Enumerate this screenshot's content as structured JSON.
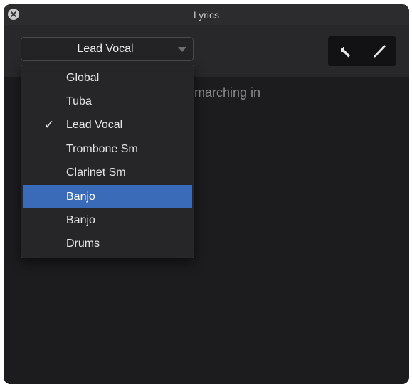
{
  "window": {
    "title": "Lyrics"
  },
  "toolbar": {
    "track_select_value": "Lead Vocal"
  },
  "content": {
    "lyric_text": "marching in"
  },
  "menu": {
    "items": [
      {
        "label": "Global",
        "checked": false,
        "highlighted": false
      },
      {
        "label": "Tuba",
        "checked": false,
        "highlighted": false
      },
      {
        "label": "Lead Vocal",
        "checked": true,
        "highlighted": false
      },
      {
        "label": "Trombone Sm",
        "checked": false,
        "highlighted": false
      },
      {
        "label": "Clarinet Sm",
        "checked": false,
        "highlighted": false
      },
      {
        "label": "Banjo",
        "checked": false,
        "highlighted": true
      },
      {
        "label": "Banjo",
        "checked": false,
        "highlighted": false
      },
      {
        "label": "Drums",
        "checked": false,
        "highlighted": false
      }
    ],
    "check_glyph": "✓"
  },
  "icons": {
    "close": "close-icon",
    "dropdown": "chevron-down-icon",
    "wrench": "wrench-icon",
    "pencil": "pencil-icon"
  },
  "colors": {
    "highlight": "#3a6bb8",
    "window_bg": "#1c1c1e",
    "toolbar_bg": "#28282a"
  }
}
